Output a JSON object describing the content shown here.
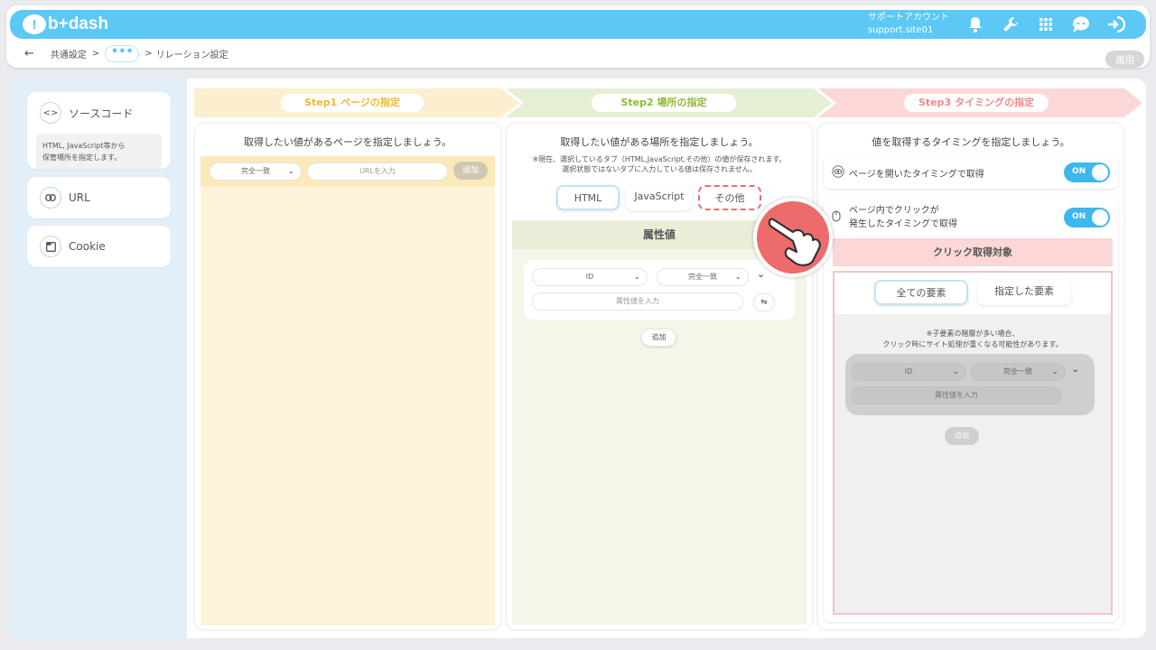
{
  "header": {
    "logo_text": "b+dash",
    "account_label": "サポートアカウント",
    "account_id": "support.site01",
    "icons": [
      "bell-icon",
      "wrench-icon",
      "grid-icon",
      "chat-bubble-icon",
      "logout-icon"
    ]
  },
  "breadcrumb": {
    "back": "←",
    "item1": "共通設定",
    "sep": ">",
    "dots": "•••",
    "item2": "リレーション設定"
  },
  "apply_label": "適用",
  "sidebar": {
    "items": [
      {
        "label": "ソースコード",
        "icon": "code-icon",
        "desc_line1": "HTML, JavaScript等から",
        "desc_line2": "保管場所を指定します。"
      },
      {
        "label": "URL",
        "icon": "link-icon"
      },
      {
        "label": "Cookie",
        "icon": "cookie-icon"
      }
    ]
  },
  "steps": [
    {
      "label": "Step1 ページの指定",
      "color": "#f3b732",
      "band": "#fbefcf"
    },
    {
      "label": "Step2 場所の指定",
      "color": "#8dbb2f",
      "band": "#e4efd3"
    },
    {
      "label": "Step3 タイミングの指定",
      "color": "#f08a8a",
      "band": "#fbd7d7"
    }
  ],
  "step1": {
    "title": "取得したい値があるページを指定しましょう。",
    "match_select": "完全一致",
    "url_placeholder": "URLを入力",
    "add_label": "追加"
  },
  "step2": {
    "title": "取得したい値がある場所を指定しましょう。",
    "note_line1": "※現在、選択しているタブ（HTML,JavaScript,その他）の値が保存されます。",
    "note_line2": "選択状態ではないタブに入力している値は保存されません。",
    "tabs": [
      "HTML",
      "JavaScript",
      "その他"
    ],
    "section_label": "属性値",
    "attr_select": "ID",
    "match_select": "完全一致",
    "attr_placeholder": "属性値を入力",
    "swap_icon": "⇋",
    "add_label": "追加"
  },
  "step3": {
    "title": "値を取得するタイミングを指定しましょう。",
    "option1": "ページを開いたタイミングで取得",
    "option2_line1": "ページ内でクリックが",
    "option2_line2": "発生したタイミングで取得",
    "toggle_on": "ON",
    "click_target_label": "クリック取得対象",
    "btn_all": "全ての要素",
    "btn_specified": "指定した要素",
    "warn_line1": "※子要素の階層が多い場合、",
    "warn_line2": "クリック時にサイト処理が重くなる可能性があります。",
    "attr_select": "ID",
    "match_select": "完全一致",
    "attr_placeholder": "属性値を入力",
    "add_label": "追加"
  }
}
